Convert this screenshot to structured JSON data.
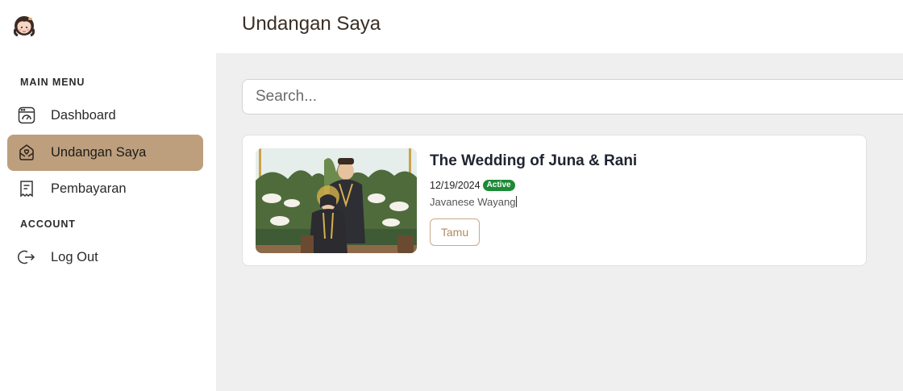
{
  "sidebar": {
    "logo_icon": "girl-avatar-logo-icon",
    "main_menu_label": "MAIN MENU",
    "account_label": "ACCOUNT",
    "items": [
      {
        "label": "Dashboard",
        "icon": "dashboard-icon"
      },
      {
        "label": "Undangan Saya",
        "icon": "heart-envelope-icon",
        "active": true
      },
      {
        "label": "Pembayaran",
        "icon": "receipt-icon"
      }
    ],
    "account_items": [
      {
        "label": "Log Out",
        "icon": "logout-icon"
      }
    ]
  },
  "header": {
    "title": "Undangan Saya"
  },
  "search": {
    "placeholder": "Search...",
    "value": ""
  },
  "invitations": [
    {
      "title": "The Wedding of Juna & Rani",
      "date": "12/19/2024",
      "status": "Active",
      "theme": "Javanese Wayang",
      "button_label": "Tamu"
    }
  ],
  "colors": {
    "accent": "#bd9f7e",
    "status_active": "#1d8a37",
    "main_bg": "#efefef",
    "button_border": "#c9a987"
  }
}
